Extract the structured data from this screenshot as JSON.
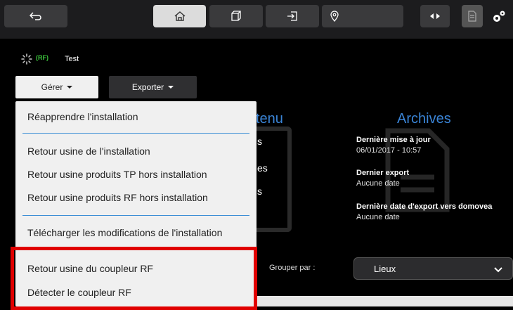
{
  "toolbar": {
    "icons": [
      "back-arrow-icon",
      "home-icon",
      "box-icon",
      "export-icon",
      "location-pin-icon",
      "arrows-icon",
      "document-icon",
      "settings-gears-icon"
    ]
  },
  "status": {
    "label": "Test",
    "rf_badge": "(RF)"
  },
  "menu": {
    "manage_label": "Gérer",
    "export_label": "Exporter"
  },
  "contenu": {
    "title_partial": "tenu",
    "fragments": [
      "s",
      "es",
      "s"
    ]
  },
  "archives": {
    "title": "Archives",
    "last_update_label": "Dernière mise à jour",
    "last_update_value": "06/01/2017 - 10:57",
    "last_export_label": "Dernier export",
    "last_export_value": "Aucune date",
    "last_domovea_label": "Dernière date d'export vers domovea",
    "last_domovea_value": "Aucune date"
  },
  "group": {
    "label": "Grouper par :",
    "value": "Lieux"
  },
  "dropdown": {
    "items": [
      "Réapprendre l'installation",
      "Retour usine de l'installation",
      "Retour usine produits TP hors installation",
      "Retour usine produits RF hors installation",
      "Télécharger les modifications de l'installation",
      "Retour usine du coupleur RF",
      "Détecter le coupleur RF"
    ]
  },
  "colors": {
    "accent": "#3a84d6",
    "highlight": "#e00000",
    "rf_green": "#3cc43c"
  }
}
